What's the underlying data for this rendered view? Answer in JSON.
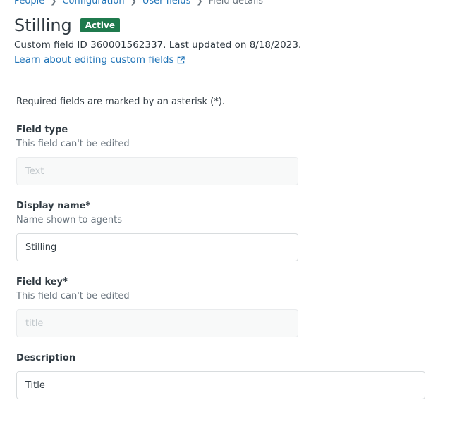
{
  "breadcrumb": {
    "items": [
      "People",
      "Configuration",
      "User fields",
      "Field details"
    ],
    "separator": ">"
  },
  "header": {
    "title": "Stilling",
    "status": "Active",
    "meta": "Custom field ID 360001562337. Last updated on 8/18/2023.",
    "help_link": "Learn about editing custom fields"
  },
  "form": {
    "required_note": "Required fields are marked by an asterisk (*).",
    "field_type": {
      "label": "Field type",
      "hint": "This field can't be edited",
      "value": "Text"
    },
    "display_name": {
      "label": "Display name*",
      "hint": "Name shown to agents",
      "value": "Stilling"
    },
    "field_key": {
      "label": "Field key*",
      "hint": "This field can't be edited",
      "value": "title"
    },
    "description": {
      "label": "Description",
      "value": "Title"
    }
  },
  "colors": {
    "status_badge": "#1f7a4d",
    "link": "#1f73b7",
    "text": "#2f3941",
    "muted": "#68737d"
  },
  "icons": {
    "external_link": "external-link-icon",
    "breadcrumb_separator": "chevron-right-icon"
  }
}
